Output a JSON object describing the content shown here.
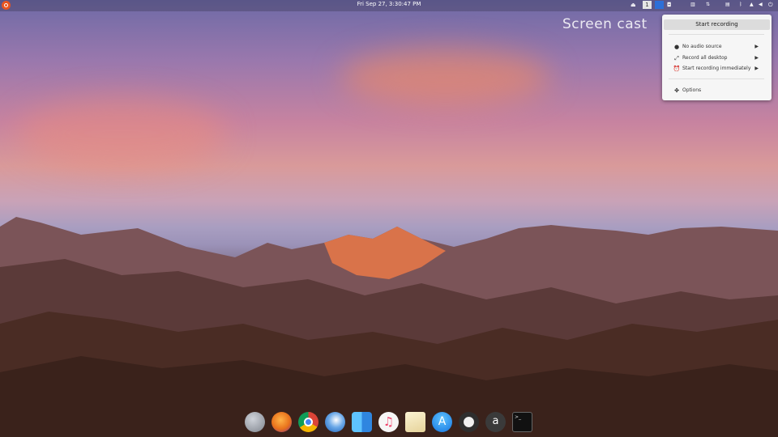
{
  "topbar": {
    "clock": "Fri Sep 27,  3:30:47 PM",
    "workspace_number": "1"
  },
  "watermark": "Screen cast",
  "recording_menu": {
    "start_label": "Start recording",
    "items": [
      {
        "icon": "microphone-icon",
        "label": "No audio source",
        "submenu": true
      },
      {
        "icon": "fullscreen-icon",
        "label": "Record all desktop",
        "submenu": true
      },
      {
        "icon": "alarm-clock-icon",
        "label": "Start recording immediately",
        "submenu": true
      },
      {
        "icon": "options-icon",
        "label": "Options",
        "submenu": false
      }
    ]
  },
  "dock": {
    "apps": [
      {
        "name": "launchpad",
        "color": "#8a8f99"
      },
      {
        "name": "firefox",
        "color": "#e8711b"
      },
      {
        "name": "chrome",
        "color": "#db4437"
      },
      {
        "name": "thunderbird",
        "color": "#2a78c8"
      },
      {
        "name": "finder",
        "color": "#2f9bf0"
      },
      {
        "name": "music",
        "color": "#f5f5f5"
      },
      {
        "name": "text-editor",
        "color": "#f0e7c8"
      },
      {
        "name": "app-store",
        "color": "#1b8ef2"
      },
      {
        "name": "settings",
        "color": "#333333"
      },
      {
        "name": "amazon",
        "color": "#2b2b2b"
      },
      {
        "name": "terminal",
        "color": "#111111"
      }
    ]
  }
}
